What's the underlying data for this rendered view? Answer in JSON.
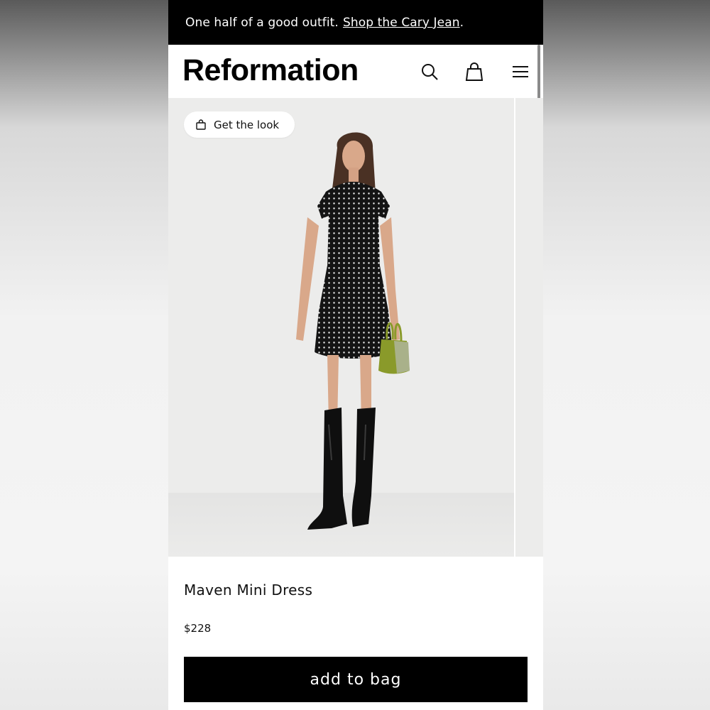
{
  "promo": {
    "text": "One half of a good outfit.",
    "link_text": "Shop the Cary Jean",
    "period": "."
  },
  "header": {
    "brand": "Reformation",
    "icons": [
      "search-icon",
      "bag-icon",
      "menu-icon"
    ]
  },
  "gallery": {
    "get_the_look_label": "Get the look",
    "image_description_icon": "product-photo"
  },
  "product": {
    "name": "Maven Mini Dress",
    "price": "$228",
    "add_to_bag_label": "add to bag"
  },
  "colors": {
    "promo_bg": "#000000",
    "button_bg": "#000000",
    "hero_bg": "#ececeb",
    "bag_accent": "#8a9a2a"
  }
}
